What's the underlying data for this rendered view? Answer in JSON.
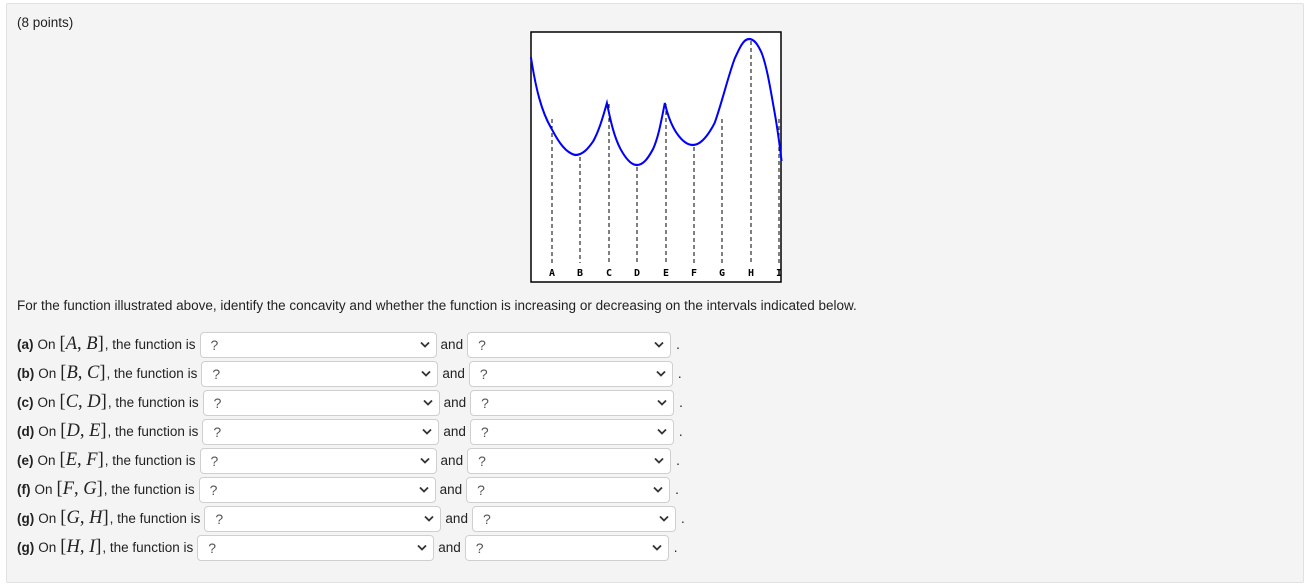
{
  "header": {
    "points": "(8 points)"
  },
  "graph": {
    "labels": [
      "A",
      "B",
      "C",
      "D",
      "E",
      "F",
      "G",
      "H",
      "I"
    ],
    "curve_color": "#0000ff",
    "description": "Piecewise curve with cusps at C and E, local minima at B, D, F, maximum at H"
  },
  "prompt": "For the function illustrated above, identify the concavity and whether the function is increasing or decreasing on the intervals indicated below.",
  "rows": [
    {
      "part": "(a)",
      "on": "On",
      "p1": "A",
      "p2": "B",
      "mid": ", the function is",
      "sel1": "?",
      "and": "and",
      "sel2": "?",
      "end": "."
    },
    {
      "part": "(b)",
      "on": "On",
      "p1": "B",
      "p2": "C",
      "mid": ", the function is",
      "sel1": "?",
      "and": "and",
      "sel2": "?",
      "end": "."
    },
    {
      "part": "(c)",
      "on": "On",
      "p1": "C",
      "p2": "D",
      "mid": ", the function is",
      "sel1": "?",
      "and": "and",
      "sel2": "?",
      "end": "."
    },
    {
      "part": "(d)",
      "on": "On",
      "p1": "D",
      "p2": "E",
      "mid": ", the function is",
      "sel1": "?",
      "and": "and",
      "sel2": "?",
      "end": "."
    },
    {
      "part": "(e)",
      "on": "On",
      "p1": "E",
      "p2": "F",
      "mid": ", the function is",
      "sel1": "?",
      "and": "and",
      "sel2": "?",
      "end": "."
    },
    {
      "part": "(f)",
      "on": "On",
      "p1": "F",
      "p2": "G",
      "mid": ", the function is",
      "sel1": "?",
      "and": "and",
      "sel2": "?",
      "end": "."
    },
    {
      "part": "(g)",
      "on": "On",
      "p1": "G",
      "p2": "H",
      "mid": ", the function is",
      "sel1": "?",
      "and": "and",
      "sel2": "?",
      "end": "."
    },
    {
      "part": "(g)",
      "on": "On",
      "p1": "H",
      "p2": "I",
      "mid": ", the function is",
      "sel1": "?",
      "and": "and",
      "sel2": "?",
      "end": "."
    }
  ]
}
